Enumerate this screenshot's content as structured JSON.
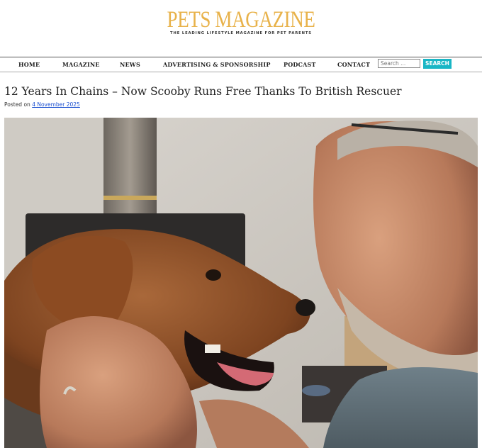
{
  "brand": {
    "title": "PETS MAGAZINE",
    "tagline": "THE LEADING LIFESTYLE MAGAZINE FOR PET PARENTS",
    "accent_color": "#e8b24a"
  },
  "nav": {
    "items": [
      "HOME",
      "MAGAZINE",
      "NEWS",
      "ADVERTISING & SPONSORSHIP",
      "PODCAST",
      "CONTACT"
    ]
  },
  "search": {
    "placeholder": "Search ...",
    "button_label": "SEARCH",
    "button_color": "#19b6c5"
  },
  "article": {
    "title": "12 Years In Chains – Now Scooby Runs Free Thanks To British Rescuer",
    "posted_prefix": "Posted on",
    "date": "4 November 2025",
    "image_alt": "Man holding a brown dog's face"
  }
}
